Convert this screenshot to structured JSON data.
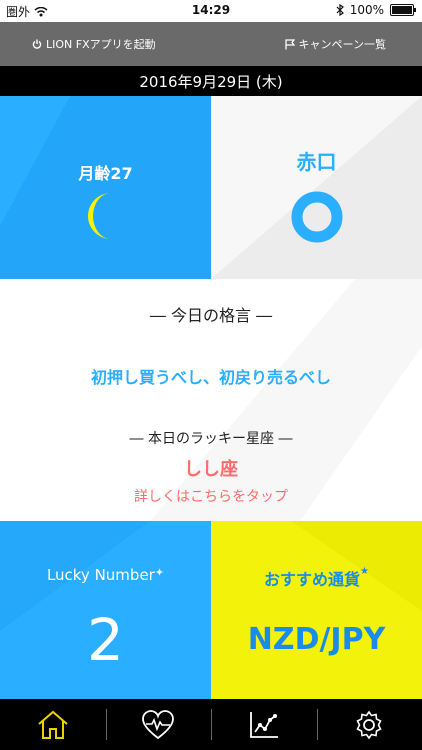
{
  "status_bar": {
    "carrier": "圏外",
    "time": "14:29",
    "battery": "100%",
    "battery_level": 1.0
  },
  "top_bar": {
    "left_button": "LION FXアプリを起動",
    "right_button": "キャンペーン一覧"
  },
  "date_label": "2016年9月29日 (木)",
  "moon": {
    "label": "月齢27"
  },
  "rokuyo": {
    "label": "赤口"
  },
  "kakugen": {
    "title": "― 今日の格言 ―",
    "text": "初押し買うべし、初戻り売るべし"
  },
  "lucky_zodiac": {
    "title": "― 本日のラッキー星座 ―",
    "sign": "しし座",
    "tap_text": "詳しくはこちらをタップ"
  },
  "lucky_number": {
    "label": "Lucky Number",
    "value": "2"
  },
  "recommended_currency": {
    "label": "おすすめ通貨",
    "value": "NZD/JPY"
  },
  "tabs": [
    "home",
    "health",
    "chart",
    "settings"
  ],
  "colors": {
    "blue": "#2aaeff",
    "yellow": "#f2f20a",
    "pink": "#ff6b6b",
    "tab_active": "#e8d200"
  }
}
